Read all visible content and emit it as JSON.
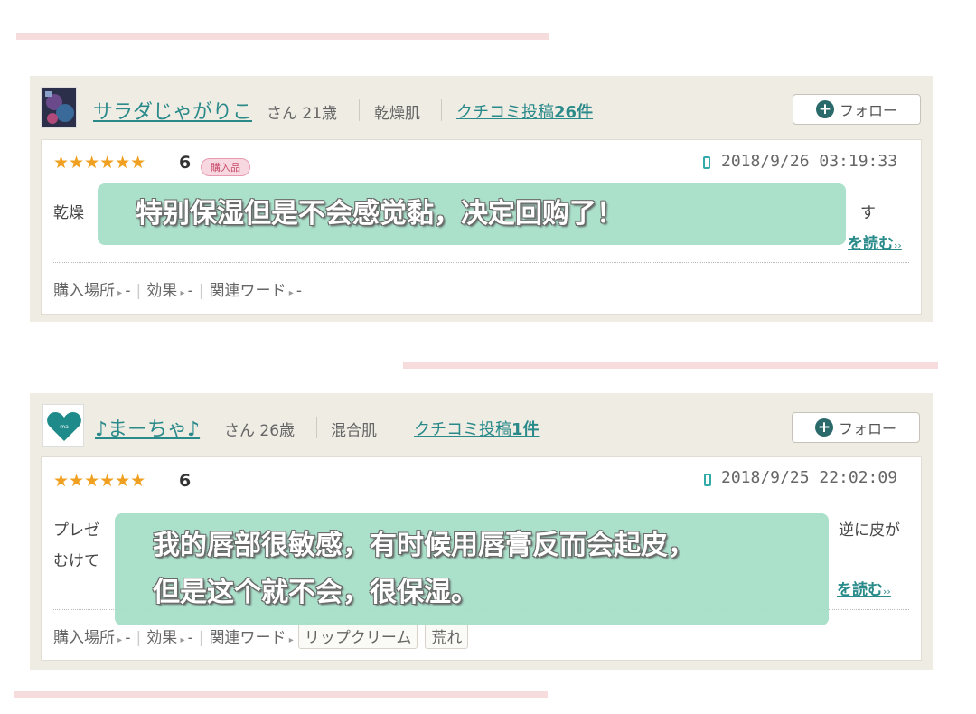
{
  "reviews": [
    {
      "username": "サラダじゃがりこ",
      "san_age": "さん 21歳",
      "skin_type": "乾燥肌",
      "reviews_prefix": "クチコミ投稿",
      "reviews_count": "26件",
      "follow_label": "フォロー",
      "stars": "★★★★★★",
      "rating": "6",
      "purchase_badge": "購入品",
      "date": "2018/9/26 03:19:33",
      "text_left": "乾燥",
      "text_right": "す",
      "read_more": "を読む",
      "meta": {
        "place_label": "購入場所",
        "place_value": "-",
        "effect_label": "効果",
        "effect_value": "-",
        "keyword_label": "関連ワード",
        "keyword_value": "-"
      },
      "overlay_lines": [
        "特别保湿但是不会感觉黏，决定回购了！"
      ]
    },
    {
      "username": "♪まーちゃ♪",
      "san_age": "さん 26歳",
      "skin_type": "混合肌",
      "reviews_prefix": "クチコミ投稿",
      "reviews_count": "1件",
      "follow_label": "フォロー",
      "stars": "★★★★★★",
      "rating": "6",
      "date": "2018/9/25 22:02:09",
      "text_left_1": "プレゼ",
      "text_left_2": "むけて",
      "text_right": "逆に皮が",
      "read_more": "を読む",
      "meta": {
        "place_label": "購入場所",
        "place_value": "-",
        "effect_label": "効果",
        "effect_value": "-",
        "keyword_label": "関連ワード",
        "tag1": "リップクリーム",
        "tag2": "荒れ"
      },
      "overlay_lines": [
        "我的唇部很敏感，有时候用唇膏反而会起皮，",
        "但是这个就不会，很保湿。"
      ]
    }
  ],
  "colors": {
    "accent": "#2a8a8a",
    "overlay": "#a6dec8",
    "star": "#f0a020",
    "pink_bar": "#f6dcdc"
  },
  "icons": [
    "plus-icon",
    "phone-icon",
    "heart-avatar-icon"
  ]
}
